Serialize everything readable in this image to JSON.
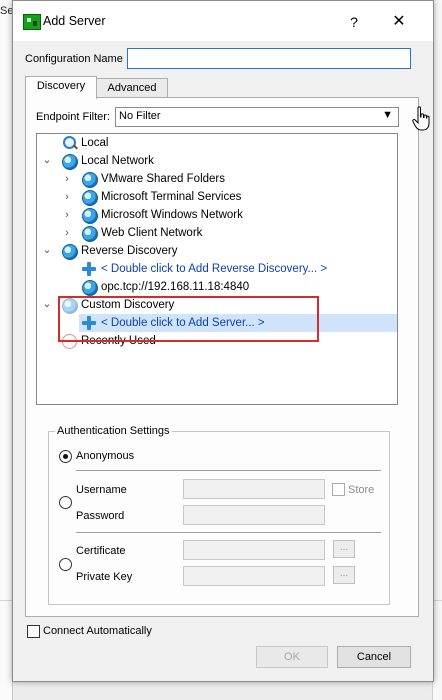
{
  "background": {
    "partial_text": "Ser"
  },
  "dialog": {
    "title": "Add Server",
    "help_label": "?",
    "close_label": "✕",
    "config_name_label": "Configuration Name",
    "config_name_value": ""
  },
  "tabs": [
    {
      "label": "Discovery",
      "active": true
    },
    {
      "label": "Advanced",
      "active": false
    }
  ],
  "endpoint_filter": {
    "label": "Endpoint Filter:",
    "value": "No Filter"
  },
  "tree": [
    {
      "label": "Local",
      "icon": "magnifier-icon",
      "chevron": "",
      "style": "normal"
    },
    {
      "label": "Local Network",
      "icon": "globe-icon",
      "chevron": "⌄",
      "style": "normal"
    },
    {
      "label": "VMware Shared Folders",
      "icon": "globe-icon",
      "chevron": "›",
      "style": "normal"
    },
    {
      "label": "Microsoft Terminal Services",
      "icon": "globe-icon",
      "chevron": "›",
      "style": "normal"
    },
    {
      "label": "Microsoft Windows Network",
      "icon": "globe-icon",
      "chevron": "›",
      "style": "normal"
    },
    {
      "label": "Web Client Network",
      "icon": "globe-icon",
      "chevron": "›",
      "style": "normal"
    },
    {
      "label": "Reverse Discovery",
      "icon": "globe-icon",
      "chevron": "⌄",
      "style": "normal"
    },
    {
      "label": "< Double click to Add Reverse Discovery... >",
      "icon": "plus-icon",
      "chevron": "",
      "style": "blue"
    },
    {
      "label": "opc.tcp://192.168.11.18:4840",
      "icon": "globe-icon",
      "chevron": "",
      "style": "normal"
    },
    {
      "label": "Custom Discovery",
      "icon": "globe-icon",
      "chevron": "⌄",
      "style": "normal"
    },
    {
      "label": "< Double click to Add Server... >",
      "icon": "plus-icon",
      "chevron": "",
      "style": "blue-selected"
    },
    {
      "label": "Recently Used",
      "icon": "recent-icon",
      "chevron": "",
      "style": "normal"
    }
  ],
  "auth": {
    "group_title": "Authentication Settings",
    "anonymous_label": "Anonymous",
    "username_label": "Username",
    "password_label": "Password",
    "store_label": "Store",
    "certificate_label": "Certificate",
    "private_key_label": "Private Key",
    "browse_label": "..."
  },
  "connect_auto_label": "Connect Automatically",
  "ok_label": "OK",
  "cancel_label": "Cancel",
  "colors": {
    "selection": "#cfe4fb",
    "highlight_box": "#d42b2b",
    "link_blue": "#0b3fb5"
  }
}
